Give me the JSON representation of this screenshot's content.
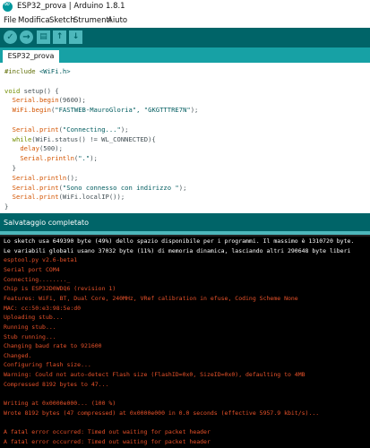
{
  "window": {
    "title": "ESP32_prova | Arduino 1.8.1"
  },
  "menu": [
    "File",
    "Modifica",
    "Sketch",
    "Strumenti",
    "Aiuto"
  ],
  "toolbar": {
    "verify": "✓",
    "upload": "→",
    "new": "▤",
    "open": "↑",
    "save": "↓"
  },
  "tab": {
    "label": "ESP32_prova"
  },
  "code": [
    {
      "p": "#include ",
      "s": "<WiFi.h>"
    },
    {
      "t": ""
    },
    {
      "k": "void",
      "r": " setup() {"
    },
    {
      "i": "  ",
      "f": "Serial.begin",
      "r": "(9600);"
    },
    {
      "i": "  ",
      "f": "WiFi.begin",
      "r": "(",
      "s": "\"FASTWEB-MauroGloria\", \"GKGTTTRE7N\"",
      "r2": ");"
    },
    {
      "t": ""
    },
    {
      "i": "  ",
      "f": "Serial.print",
      "r": "(",
      "s": "\"Connecting...\"",
      "r2": ");"
    },
    {
      "i": "  ",
      "k": "while",
      "r": "(WiFi.status() != WL_CONNECTED){"
    },
    {
      "i": "    ",
      "f": "delay",
      "r": "(500);"
    },
    {
      "i": "    ",
      "f": "Serial.println",
      "r": "(",
      "s": "\".\"",
      "r2": ");"
    },
    {
      "t": "  }"
    },
    {
      "i": "  ",
      "f": "Serial.println",
      "r": "();"
    },
    {
      "i": "  ",
      "f": "Serial.print",
      "r": "(",
      "s": "\"Sono connesso con indirizzo \"",
      "r2": ");"
    },
    {
      "i": "  ",
      "f": "Serial.print",
      "r": "(WiFi.localIP());"
    },
    {
      "t": "}"
    }
  ],
  "status": {
    "message": "Salvataggio completato"
  },
  "console": [
    {
      "c": "white",
      "t": "Lo sketch usa 649390 byte (49%) dello spazio disponibile per i programmi. Il massimo è 1310720 byte."
    },
    {
      "c": "white",
      "t": "Le variabili globali usano 37032 byte (11%) di memoria dinamica, lasciando altri 290648 byte liberi"
    },
    {
      "c": "orange",
      "t": "esptool.py v2.6-beta1"
    },
    {
      "c": "orange",
      "t": "Serial port COM4"
    },
    {
      "c": "orange",
      "t": "Connecting........_"
    },
    {
      "c": "orange",
      "t": "Chip is ESP32D0WDQ6 (revision 1)"
    },
    {
      "c": "orange",
      "t": "Features: WiFi, BT, Dual Core, 240MHz, VRef calibration in efuse, Coding Scheme None"
    },
    {
      "c": "orange",
      "t": "MAC: cc:50:e3:98:5e:d0"
    },
    {
      "c": "orange",
      "t": "Uploading stub..."
    },
    {
      "c": "orange",
      "t": "Running stub..."
    },
    {
      "c": "orange",
      "t": "Stub running..."
    },
    {
      "c": "orange",
      "t": "Changing baud rate to 921600"
    },
    {
      "c": "orange",
      "t": "Changed."
    },
    {
      "c": "orange",
      "t": "Configuring flash size..."
    },
    {
      "c": "orange",
      "t": "Warning: Could not auto-detect Flash size (FlashID=0x0, SizeID=0x0), defaulting to 4MB"
    },
    {
      "c": "orange",
      "t": "Compressed 8192 bytes to 47..."
    },
    {
      "c": "orange",
      "t": ""
    },
    {
      "c": "orange",
      "t": "Writing at 0x0000e000... (100 %)"
    },
    {
      "c": "orange",
      "t": "Wrote 8192 bytes (47 compressed) at 0x0000e000 in 0.0 seconds (effective 5957.9 kbit/s)..."
    },
    {
      "c": "orange",
      "t": ""
    },
    {
      "c": "orange",
      "t": "A fatal error occurred: Timed out waiting for packet header"
    },
    {
      "c": "orange",
      "t": "A fatal error occurred: Timed out waiting for packet header"
    }
  ]
}
